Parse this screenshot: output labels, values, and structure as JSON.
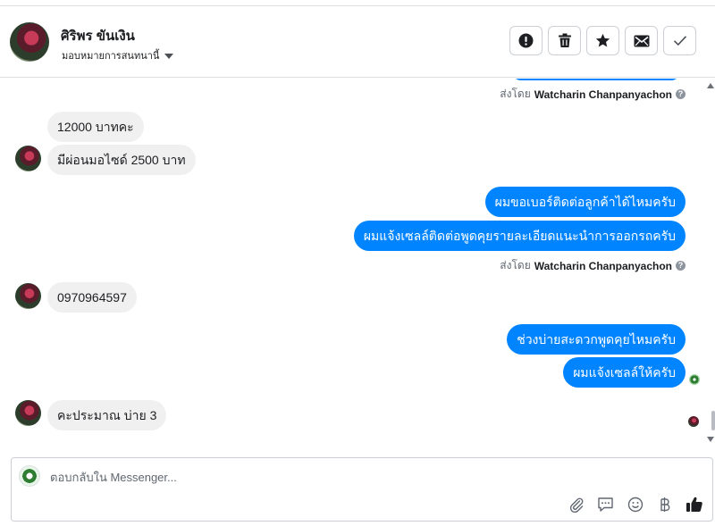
{
  "header": {
    "contact_name": "ศิริพร ขันเงิน",
    "assign_label": "มอบหมายการสนทนานี้",
    "actions": [
      {
        "name": "spam",
        "icon": "exclamation-icon"
      },
      {
        "name": "delete",
        "icon": "trash-icon"
      },
      {
        "name": "star",
        "icon": "star-icon"
      },
      {
        "name": "mark-unread",
        "icon": "envelope-icon"
      },
      {
        "name": "done",
        "icon": "check-icon"
      }
    ]
  },
  "sent_by": {
    "prefix": "ส่งโดย",
    "name": "Watcharin Chanpanyachon"
  },
  "messages": {
    "m1": "12000 บาทคะ",
    "m2": "มีผ่อนมอไซด์ 2500 บาท",
    "m3": "ผมขอเบอร์ติดต่อลูกค้าได้ไหมครับ",
    "m4": "ผมแจ้งเซลล์ติดต่อพูดคุยรายละเอียดแนะนำการออกรถครับ",
    "m5": "0970964597",
    "m6": "ช่วงบ่ายสะดวกพูดคุยไหมครับ",
    "m7": "ผมแจ้งเซลล์ให้ครับ",
    "m8": "คะประมาณ บ่าย 3"
  },
  "composer": {
    "placeholder": "ตอบกลับใน Messenger...",
    "icons": [
      "attach-icon",
      "saved-reply-icon",
      "emoji-icon",
      "baht-icon",
      "like-icon"
    ]
  },
  "colors": {
    "outgoing": "#0084ff",
    "incoming": "#f1f0f0"
  }
}
